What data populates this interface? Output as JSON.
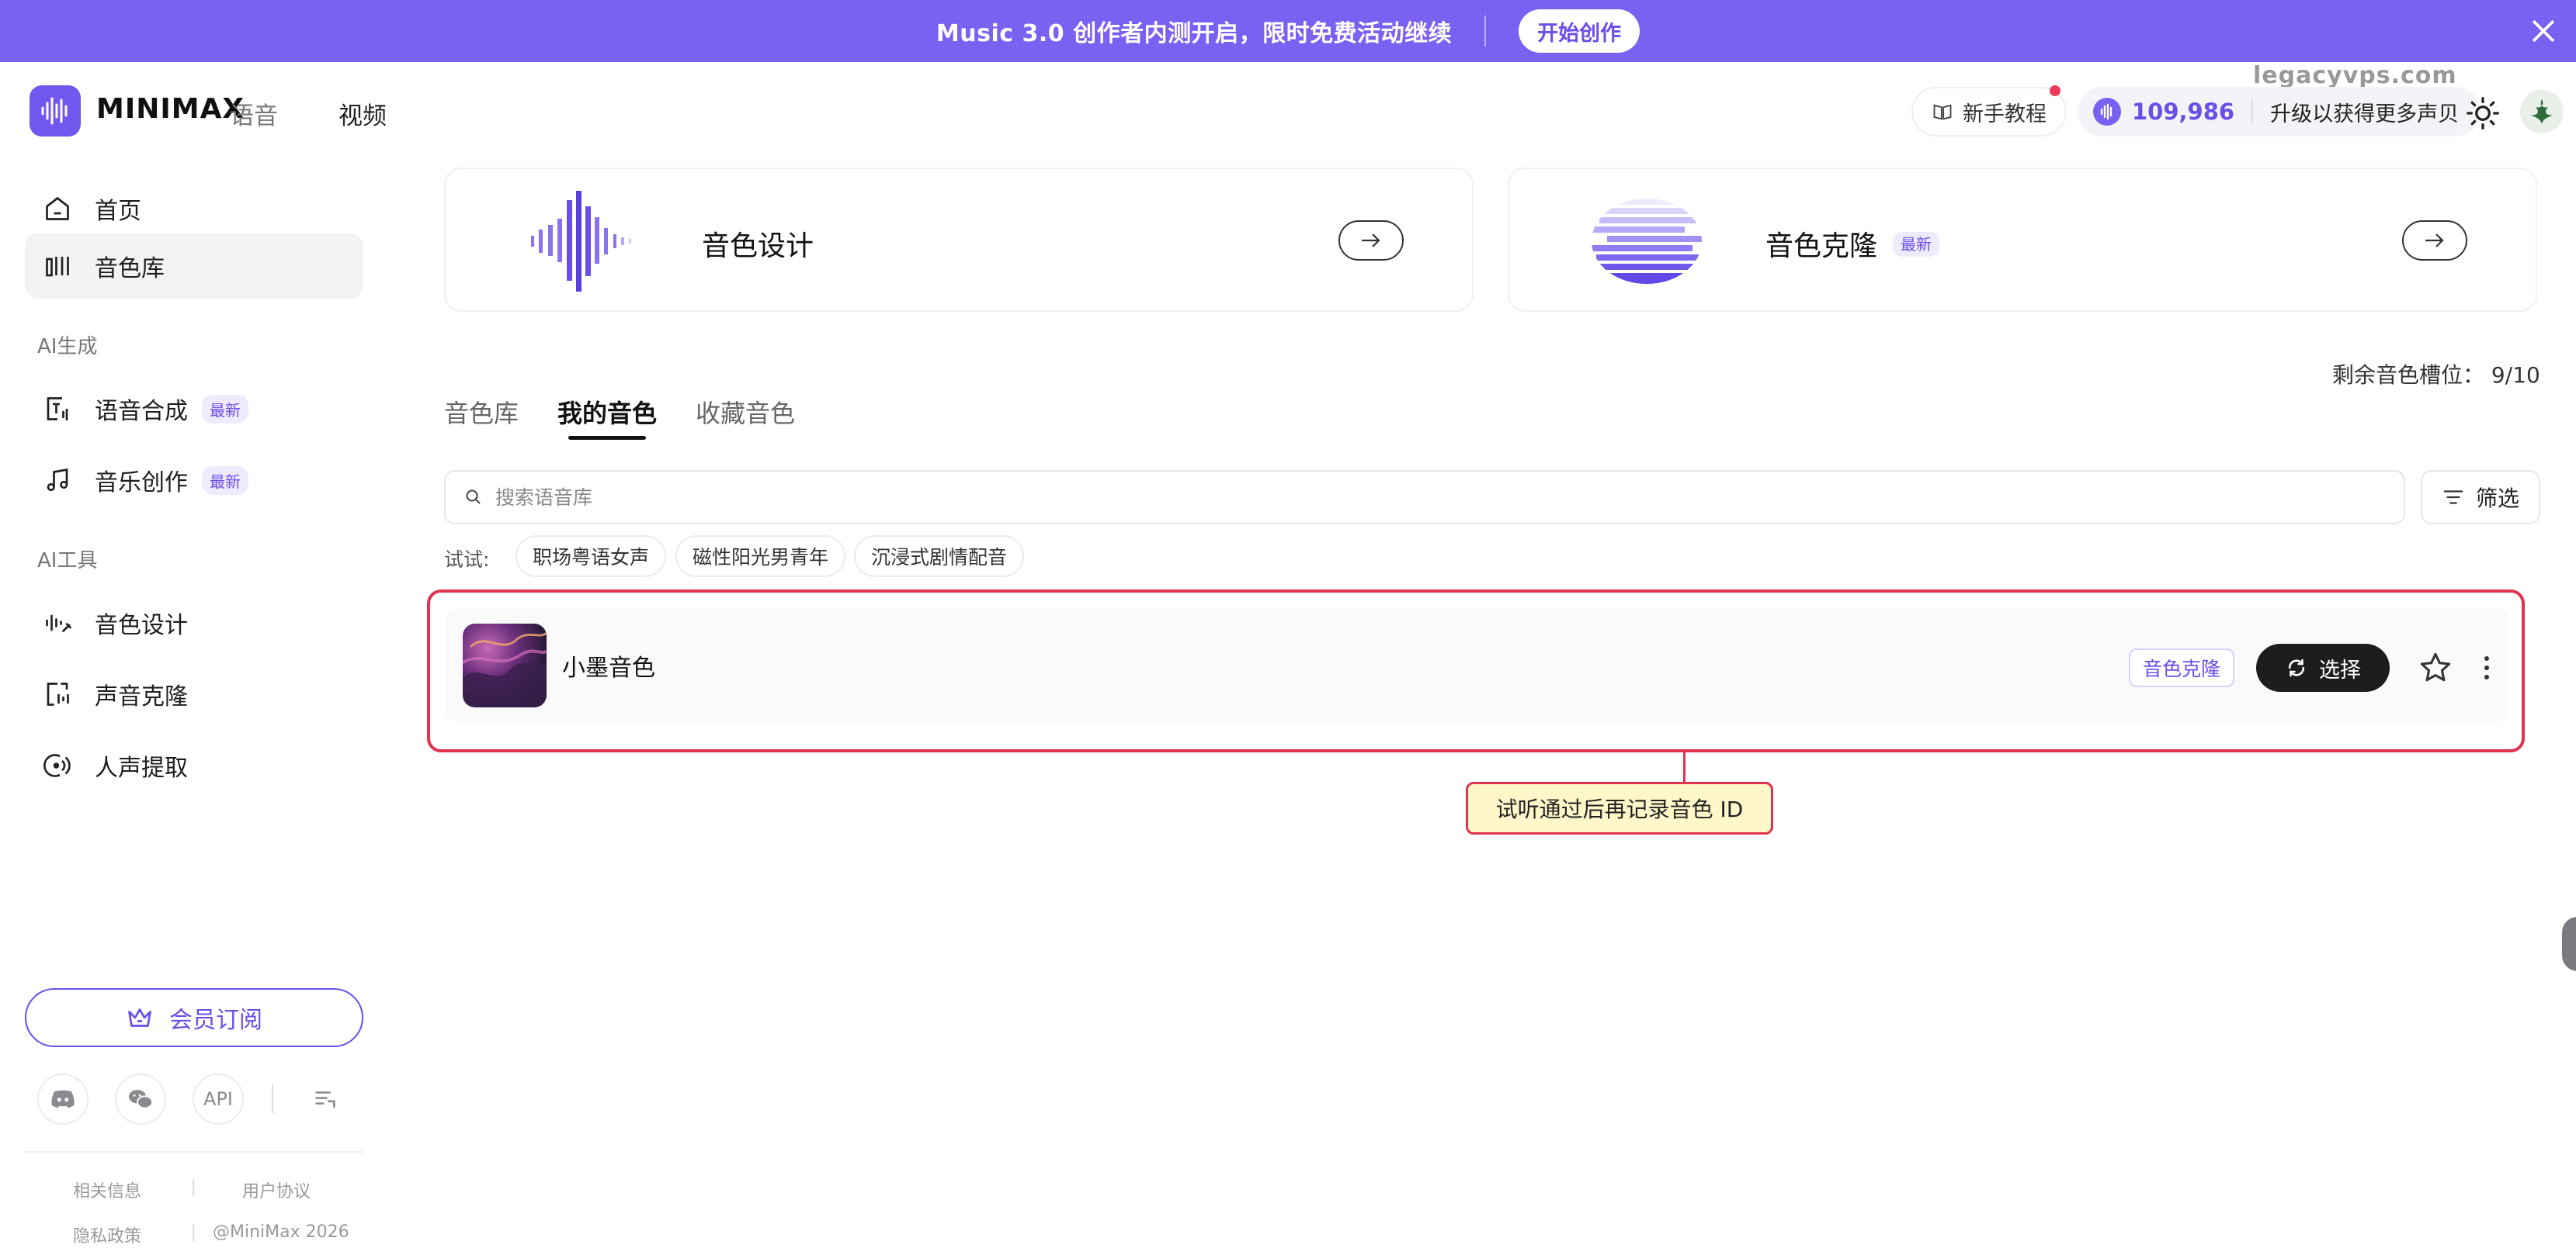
{
  "banner": {
    "text": "Music 3.0 创作者内测开启，限时免费活动继续",
    "button": "开始创作"
  },
  "header": {
    "logo": "MINIMAX",
    "nav_voice": "语音",
    "nav_video": "视频",
    "watermark": "legacyvps.com",
    "tutorial": "新手教程",
    "credits_value": "109,986",
    "credits_upgrade": "升级以获得更多声贝"
  },
  "sidebar": {
    "home": "首页",
    "voice_library": "音色库",
    "section_ai_gen": "AI生成",
    "tts": "语音合成",
    "music": "音乐创作",
    "badge_new": "最新",
    "section_ai_tools": "AI工具",
    "voice_design": "音色设计",
    "voice_clone": "声音克隆",
    "vocal_extract": "人声提取",
    "member": "会员订阅",
    "api": "API",
    "footer": {
      "related": "相关信息",
      "terms": "用户协议",
      "privacy": "隐私政策",
      "copyright": "@MiniMax 2026"
    }
  },
  "cards": {
    "design_title": "音色设计",
    "clone_title": "音色克隆",
    "clone_badge": "最新"
  },
  "tabs": {
    "library": "音色库",
    "mine": "我的音色",
    "favorites": "收藏音色"
  },
  "slots": "剩余音色槽位：  9/10",
  "search": {
    "placeholder": "搜索语音库"
  },
  "filter": "筛选",
  "try": {
    "label": "试试:",
    "chips": [
      "职场粤语女声",
      "磁性阳光男青年",
      "沉浸式剧情配音"
    ]
  },
  "voice": {
    "name": "小墨音色",
    "tag": "音色克隆",
    "select": "选择"
  },
  "callout": "试听通过后再记录音色 ID",
  "colors": {
    "brand": "#7b61f2",
    "accent": "#6a4ee8",
    "highlight": "#e0334f",
    "callout_bg": "#fff6c9"
  }
}
